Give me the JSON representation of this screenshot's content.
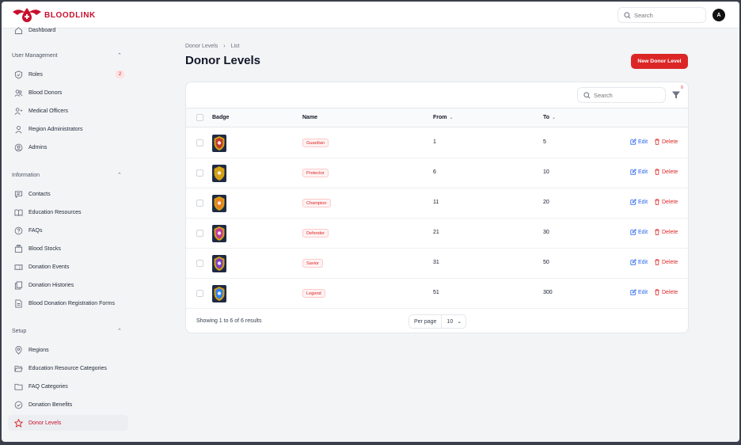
{
  "app": {
    "name": "BLOODLINK"
  },
  "topbar": {
    "search_placeholder": "Search",
    "avatar_initial": "A"
  },
  "sidebar": {
    "partial_top_label": "Dashboard",
    "groups": [
      {
        "label": "User Management",
        "items": [
          {
            "label": "Roles",
            "icon": "shield-icon",
            "badge": "2"
          },
          {
            "label": "Blood Donors",
            "icon": "users-icon"
          },
          {
            "label": "Medical Officers",
            "icon": "user-group-icon"
          },
          {
            "label": "Region Administrators",
            "icon": "user-icon"
          },
          {
            "label": "Admins",
            "icon": "user-circle-icon"
          }
        ]
      },
      {
        "label": "Information",
        "items": [
          {
            "label": "Contacts",
            "icon": "chat-icon"
          },
          {
            "label": "Education Resources",
            "icon": "book-icon"
          },
          {
            "label": "FAQs",
            "icon": "question-icon"
          },
          {
            "label": "Blood Stocks",
            "icon": "stack-icon"
          },
          {
            "label": "Donation Events",
            "icon": "ticket-icon"
          },
          {
            "label": "Donation Histories",
            "icon": "documents-icon"
          },
          {
            "label": "Blood Donation Registration Forms",
            "icon": "document-icon"
          }
        ]
      },
      {
        "label": "Setup",
        "items": [
          {
            "label": "Regions",
            "icon": "map-pin-icon"
          },
          {
            "label": "Education Resource Categories",
            "icon": "folder-open-icon"
          },
          {
            "label": "FAQ Categories",
            "icon": "folder-icon"
          },
          {
            "label": "Donation Benefits",
            "icon": "check-circle-icon"
          },
          {
            "label": "Donor Levels",
            "icon": "star-icon",
            "active": true
          }
        ]
      }
    ]
  },
  "breadcrumb": [
    "Donor Levels",
    "List"
  ],
  "page_title": "Donor Levels",
  "new_button": "New Donor Level",
  "table": {
    "search_placeholder": "Search",
    "filter_count": "0",
    "columns": {
      "badge": "Badge",
      "name": "Name",
      "from": "From",
      "to": "To"
    },
    "rows": [
      {
        "name": "Guardian",
        "from": "1",
        "to": "5",
        "color": "#c0392b"
      },
      {
        "name": "Protector",
        "from": "6",
        "to": "10",
        "color": "#d4a017"
      },
      {
        "name": "Champion",
        "from": "11",
        "to": "20",
        "color": "#e67e22"
      },
      {
        "name": "Defender",
        "from": "21",
        "to": "30",
        "color": "#c0399b"
      },
      {
        "name": "Savior",
        "from": "31",
        "to": "50",
        "color": "#7b3fbf"
      },
      {
        "name": "Legend",
        "from": "51",
        "to": "300",
        "color": "#2f80ed"
      }
    ],
    "edit_label": "Edit",
    "delete_label": "Delete",
    "footer": "Showing 1 to 6 of 6 results",
    "per_page_label": "Per page",
    "per_page_value": "10"
  },
  "colors": {
    "brand": "#c8102e",
    "danger": "#dc2626",
    "link": "#2563eb"
  }
}
